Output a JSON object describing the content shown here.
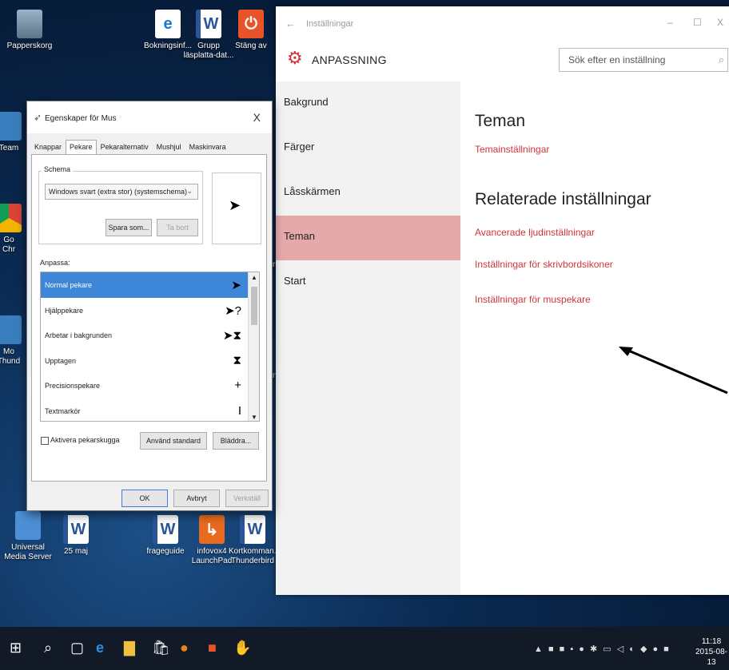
{
  "desktop": {
    "icons": {
      "recycle": "Papperskorg",
      "booking": "Bokningsinf...",
      "grupp": "Grupp läsplatta-dat...",
      "stang": "Stäng av",
      "universal": "Universal Media Server",
      "maj": "25 maj",
      "frageguide": "frageguide",
      "infovox": "infovox4 LaunchPad",
      "kortkommand": "Kortkomman... Thunderbird"
    },
    "partials": {
      "team": "Team",
      "go": "Go",
      "chr": "Chr",
      "mo": "Mo",
      "thund": "Thund",
      "rd": "rd",
      "n": "n.",
      "s": "s"
    }
  },
  "settings": {
    "window_title": "Inställningar",
    "header_title": "ANPASSNING",
    "search_placeholder": "Sök efter en inställning",
    "nav": [
      "Bakgrund",
      "Färger",
      "Låsskärmen",
      "Teman",
      "Start"
    ],
    "active_nav": "Teman",
    "heading_themes": "Teman",
    "link_theme_settings": "Temainställningar",
    "heading_related": "Relaterade inställningar",
    "links": [
      "Avancerade ljudinställningar",
      "Inställningar för skrivbordsikoner",
      "Inställningar för muspekare"
    ],
    "accent": "#d13438"
  },
  "mouse_dialog": {
    "title": "Egenskaper för Mus",
    "tabs": [
      "Knappar",
      "Pekare",
      "Pekaralternativ",
      "Mushjul",
      "Maskinvara"
    ],
    "active_tab": "Pekare",
    "scheme_label": "Schema",
    "scheme_value": "Windows svart (extra stor) (systemschema)",
    "save_as": "Spara som...",
    "delete": "Ta bort",
    "customize_label": "Anpassa:",
    "pointers": [
      {
        "name": "Normal pekare",
        "cursor": "arrow"
      },
      {
        "name": "Hjälppekare",
        "cursor": "help"
      },
      {
        "name": "Arbetar i bakgrunden",
        "cursor": "working"
      },
      {
        "name": "Upptagen",
        "cursor": "busy"
      },
      {
        "name": "Precisionspekare",
        "cursor": "crosshair"
      },
      {
        "name": "Textmarkör",
        "cursor": "ibeam"
      }
    ],
    "pointer_glyphs": [
      "➤",
      "➤?",
      "➤⧗",
      "⧗",
      "+",
      "I"
    ],
    "shadow_label": "Aktivera pekarskugga",
    "use_default": "Använd standard",
    "browse": "Bläddra...",
    "ok": "OK",
    "cancel": "Avbryt",
    "apply": "Verkställ"
  },
  "taskbar": {
    "time": "11:18",
    "date": "2015-08-13"
  }
}
